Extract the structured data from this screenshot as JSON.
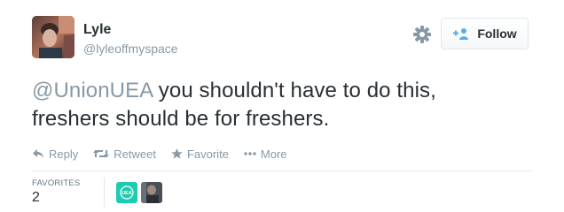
{
  "user": {
    "fullname": "Lyle",
    "username": "@lyleoffmyspace",
    "avatar_icon": "profile-photo"
  },
  "follow_button": {
    "label": "Follow",
    "icon": "add-user-icon"
  },
  "tweet": {
    "mention": "@UnionUEA",
    "text_line1_rest": " you shouldn't have to do this,",
    "text_line2": "freshers should be for freshers."
  },
  "actions": {
    "reply": "Reply",
    "retweet": "Retweet",
    "favorite": "Favorite",
    "more": "More"
  },
  "stats": {
    "favorites_label": "FAVORITES",
    "favorites_count": "2"
  },
  "favoriters": [
    {
      "logo_text": "UEA"
    },
    {
      "avatar_icon": "profile-photo"
    }
  ],
  "colors": {
    "text": "#292f33",
    "muted": "#8899a6",
    "link_blue": "#55acee",
    "border": "#e1e8ed",
    "teal": "#1ccbb0"
  }
}
